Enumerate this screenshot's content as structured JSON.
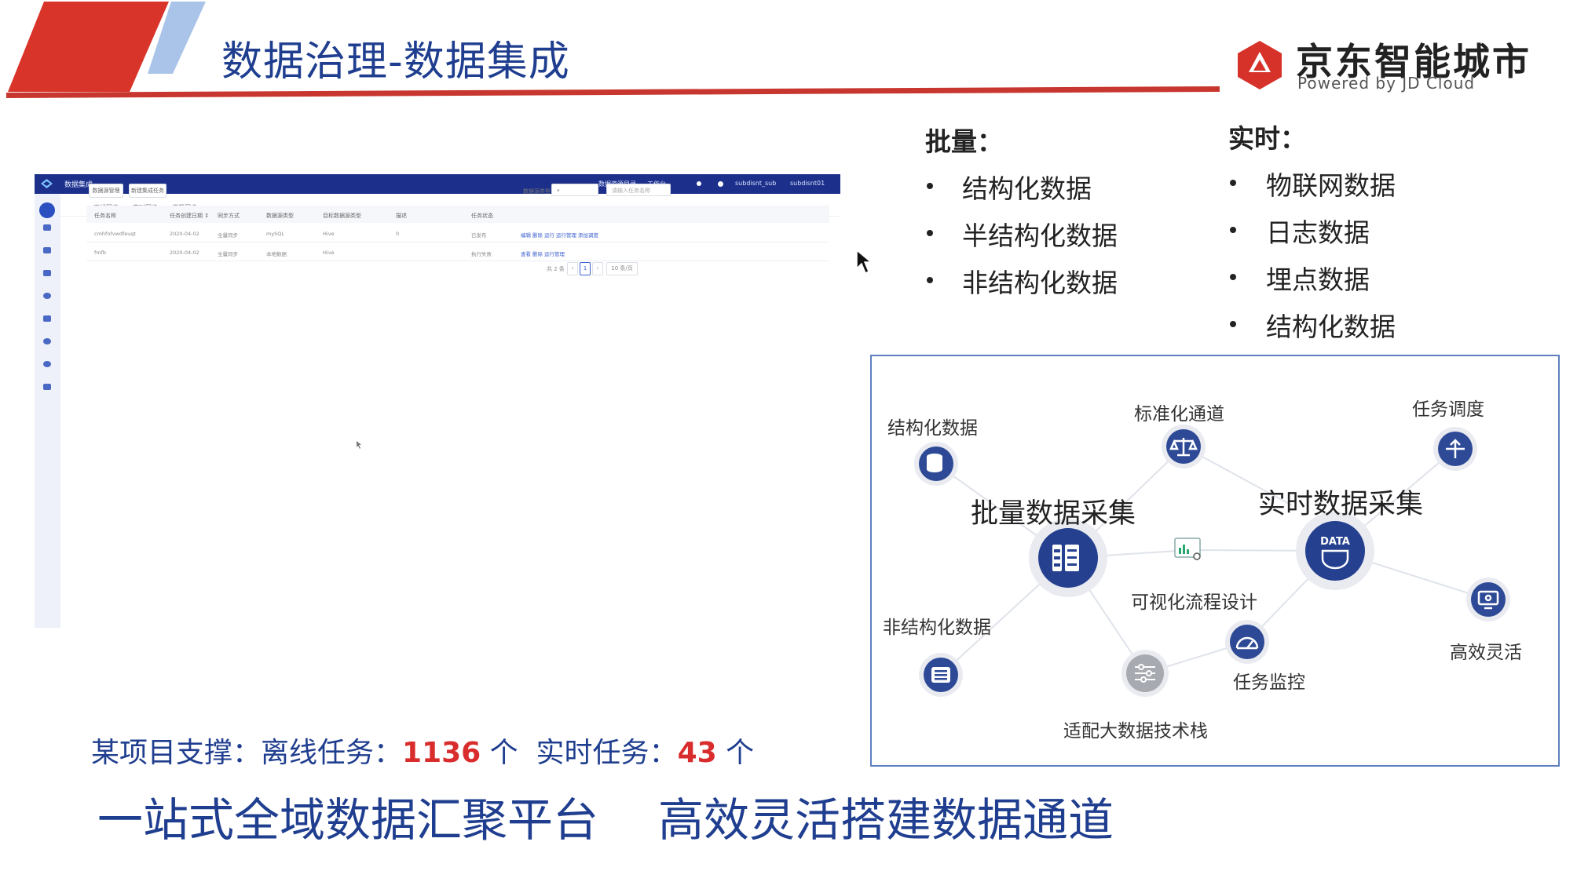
{
  "slide": {
    "title": "数据治理-数据集成",
    "brand_name": "京东智能城市",
    "brand_sub": "Powered by JD Cloud"
  },
  "colors": {
    "primary_blue": "#1f3e8f",
    "accent_red": "#d92c2c",
    "app_topbar": "#1b2f8b",
    "node_blue": "#25408f",
    "diagram_border": "#5e7fbf"
  },
  "app": {
    "title": "数据集成",
    "topnav": [
      "数据资源目录",
      "工作台",
      "subdisnt_sub",
      "subdisnt01"
    ],
    "sidebar_icons": [
      "home-icon",
      "grid-icon",
      "cloud-icon",
      "shuffle-icon",
      "pie-icon",
      "list-icon",
      "globe-icon",
      "compass-icon",
      "user-icon"
    ],
    "tabs": [
      "离线同步",
      "实时同步",
      "增量同步"
    ],
    "buttons": [
      "数据源管理",
      "新建集成任务"
    ],
    "filter_label": "数据源类型",
    "search_placeholder": "请输入任务名称",
    "table_headers": [
      "任务名称",
      "任务创建日期 ↕",
      "同步方式",
      "数据源类型",
      "目标数据源类型",
      "描述",
      "任务状态"
    ],
    "rows": [
      {
        "cells": [
          "cmhfnfvwdfeuqt",
          "2020-04-02",
          "全量同步",
          "mySQL",
          "Hive",
          "0",
          "已发布"
        ],
        "ops": [
          "编辑",
          "删除",
          "运行",
          "运行管理",
          "添加调度"
        ]
      },
      {
        "cells": [
          "fmfb",
          "2020-04-02",
          "全量同步",
          "本地数据",
          "Hive",
          "",
          "执行失败"
        ],
        "ops": [
          "查看",
          "删除",
          "运行管理"
        ]
      }
    ],
    "pagination": {
      "total": "共 2 条",
      "prev": "‹",
      "current": "1",
      "next": "›",
      "page_size": "10 条/页"
    }
  },
  "batch": {
    "heading": "批量：",
    "items": [
      "结构化数据",
      "半结构化数据",
      "非结构化数据"
    ]
  },
  "realtime": {
    "heading": "实时：",
    "items": [
      "物联网数据",
      "日志数据",
      "埋点数据",
      "结构化数据"
    ]
  },
  "diagram": {
    "batch_collect": "批量数据采集",
    "realtime_collect": "实时数据采集",
    "structured": "结构化数据",
    "unstructured": "非结构化数据",
    "std_channel": "标准化通道",
    "task_schedule": "任务调度",
    "visual_flow": "可视化流程设计",
    "task_monitor": "任务监控",
    "bigdata_stack": "适配大数据技术栈",
    "efficient": "高效灵活",
    "data_text": "DATA"
  },
  "stats": {
    "prefix": "某项目支撑：离线任务：",
    "offline_count": "1136",
    "mid": " 个  实时任务：",
    "realtime_count": "43",
    "suffix": " 个"
  },
  "taglines": [
    "一站式全域数据汇聚平台",
    "高效灵活搭建数据通道"
  ]
}
